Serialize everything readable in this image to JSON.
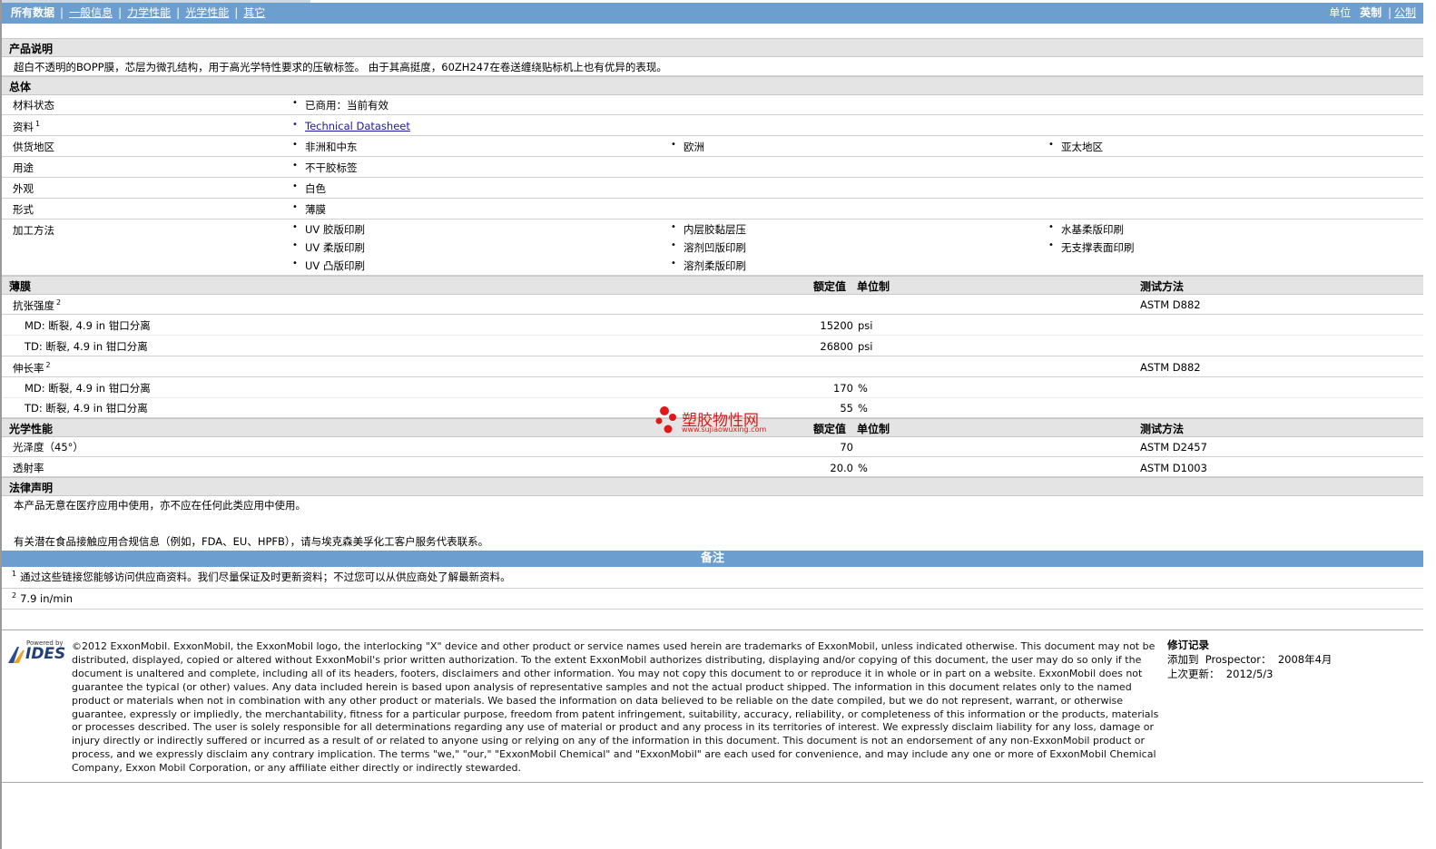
{
  "nav": {
    "items": [
      "所有数据",
      "一般信息",
      "力学性能",
      "光学性能",
      "其它"
    ],
    "units_label": "单位",
    "unit_english": "英制",
    "unit_metric": "公制"
  },
  "product": {
    "section": "产品说明",
    "description": "超白不透明的BOPP膜，芯层为微孔结构，用于高光学特性要求的压敏标签。 由于其高挺度，60ZH247在卷送缠绕贴标机上也有优异的表现。"
  },
  "general": {
    "section": "总体",
    "rows": {
      "status_label": "材料状态",
      "status_value": "已商用：当前有效",
      "docs_label": "资料",
      "docs_sup": "1",
      "docs_value": "Technical Datasheet",
      "region_label": "供货地区",
      "region_1": "非洲和中东",
      "region_2": "欧洲",
      "region_3": "亚太地区",
      "use_label": "用途",
      "use_value": "不干胶标签",
      "appearance_label": "外观",
      "appearance_value": "白色",
      "form_label": "形式",
      "form_value": "薄膜",
      "process_label": "加工方法",
      "process": [
        "UV 胶版印刷",
        "UV 柔版印刷",
        "UV 凸版印刷",
        "内层胶黏层压",
        "溶剂凹版印刷",
        "溶剂柔版印刷",
        "水基柔版印刷",
        "无支撑表面印刷"
      ]
    }
  },
  "film": {
    "section": "薄膜",
    "h_value": "额定值",
    "h_unit": "单位制",
    "h_method": "测试方法",
    "tensile_label": "抗张强度",
    "tensile_sup": "2",
    "tensile_method": "ASTM D882",
    "tensile_md_label": "MD: 断裂, 4.9 in 钳口分离",
    "tensile_md_value": "15200",
    "tensile_md_unit": "psi",
    "tensile_td_label": "TD: 断裂, 4.9 in 钳口分离",
    "tensile_td_value": "26800",
    "tensile_td_unit": "psi",
    "elong_label": "伸长率",
    "elong_sup": "2",
    "elong_method": "ASTM D882",
    "elong_md_label": "MD: 断裂, 4.9 in 钳口分离",
    "elong_md_value": "170",
    "elong_md_unit": "%",
    "elong_td_label": "TD: 断裂, 4.9 in 钳口分离",
    "elong_td_value": "55",
    "elong_td_unit": "%"
  },
  "optical": {
    "section": "光学性能",
    "h_value": "额定值",
    "h_unit": "单位制",
    "h_method": "测试方法",
    "gloss_label": "光泽度（45°）",
    "gloss_value": "70",
    "gloss_method": "ASTM D2457",
    "trans_label": "透射率",
    "trans_value": "20.0",
    "trans_unit": "%",
    "trans_method": "ASTM D1003"
  },
  "legal": {
    "section": "法律声明",
    "line1": "本产品无意在医疗应用中使用，亦不应在任何此类应用中使用。",
    "line2": "有关潜在食品接触应用合规信息（例如，FDA、EU、HPFB），请与埃克森美孚化工客户服务代表联系。"
  },
  "notes": {
    "title": "备注",
    "n1_sup": "1",
    "n1": "通过这些链接您能够访问供应商资料。我们尽量保证及时更新资料；不过您可以从供应商处了解最新资料。",
    "n2_sup": "2",
    "n2": "7.9 in/min"
  },
  "footer": {
    "logo_small": "Powered by",
    "logo_text": "IDES",
    "disclaimer": "©2012 ExxonMobil. ExxonMobil, the ExxonMobil logo, the interlocking \"X\" device and other product or service names used herein are trademarks of ExxonMobil, unless indicated otherwise. This document may not be distributed, displayed, copied or altered without ExxonMobil's prior written authorization. To the extent ExxonMobil authorizes distributing, displaying and/or copying of this document, the user may do so only if the document is unaltered and complete, including all of its headers, footers, disclaimers and other information. You may not copy this document to or reproduce it in whole or in part on a website. ExxonMobil does not guarantee the typical (or other) values. Any data included herein is based upon analysis of representative samples and not the actual product shipped. The information in this document relates only to the named product or materials when not in combination with any other product or materials. We based the information on data believed to be reliable on the date compiled, but we do not represent, warrant, or otherwise guarantee, expressly or impliedly, the merchantability, fitness for a particular purpose, freedom from patent infringement, suitability, accuracy, reliability, or completeness of this information or the products, materials or processes described. The user is solely responsible for all determinations regarding any use of material or product and any process in its territories of interest. We expressly disclaim liability for any loss, damage or injury directly or indirectly suffered or incurred as a result of or related to anyone using or relying on any of the information in this document. This document is not an endorsement of any non-ExxonMobil product or process, and we expressly disclaim any contrary implication. The terms \"we,\" \"our,\" \"ExxonMobil Chemical\" and \"ExxonMobil\" are each used for convenience, and may include any one or more of ExxonMobil Chemical Company, Exxon Mobil Corporation, or any affiliate either directly or indirectly stewarded.",
    "rev_title": "修订记录",
    "rev_added": "添加到  Prospector：  2008年4月",
    "rev_updated": "上次更新：  2012/5/3"
  },
  "watermark": {
    "text": "塑胶物性网",
    "url": "www.sujiaowuxing.com"
  }
}
